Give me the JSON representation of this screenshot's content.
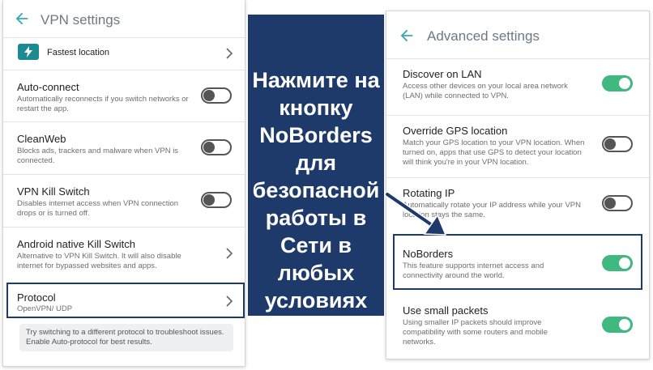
{
  "left_panel": {
    "title": "VPN settings",
    "fastest_location": "Fastest location",
    "items": [
      {
        "title": "Auto-connect",
        "desc": "Automatically reconnects if you switch networks or restart the app."
      },
      {
        "title": "CleanWeb",
        "desc": "Blocks ads, trackers and malware when VPN is connected."
      },
      {
        "title": "VPN Kill Switch",
        "desc": "Disables internet access when VPN connection drops or is turned off."
      },
      {
        "title": "Android native Kill Switch",
        "desc": "Alternative to VPN Kill Switch. It will also disable internet for bypassed websites and apps."
      },
      {
        "title": "Protocol",
        "desc": "OpenVPN/ UDP"
      }
    ],
    "note": "Try switching to a different protocol to troubleshoot issues. Enable Auto-protocol for best results.",
    "toggle_states": {
      "auto_connect": false,
      "cleanweb": false,
      "kill_switch": false
    }
  },
  "banner": {
    "text": "Нажмите на кнопку NoBorders для безопасной работы в Сети в любых условиях"
  },
  "right_panel": {
    "title": "Advanced settings",
    "items": [
      {
        "title": "Discover on LAN",
        "desc": "Access other devices on your local area network (LAN) while connected to VPN.",
        "on": true
      },
      {
        "title": "Override GPS location",
        "desc": "Match your GPS location to your VPN location. When turned on, apps that use GPS to detect your location will think you're in your VPN location.",
        "on": false
      },
      {
        "title": "Rotating IP",
        "desc": "Automatically rotate your IP address while your VPN location stays the same.",
        "on": false
      },
      {
        "title": "NoBorders",
        "desc": "This feature supports internet access and connectivity around the world.",
        "on": true
      },
      {
        "title": "Use small packets",
        "desc": "Using smaller IP packets should improve compatibility with some routers and mobile networks.",
        "on": true
      }
    ]
  },
  "colors": {
    "accent_green": "#3fb97f",
    "banner_blue": "#1e3a6b",
    "icon_teal": "#1b8b8f"
  },
  "icons": [
    "back-arrow-icon",
    "lightning-icon",
    "chevron-right-icon",
    "pointer-arrow-icon"
  ]
}
